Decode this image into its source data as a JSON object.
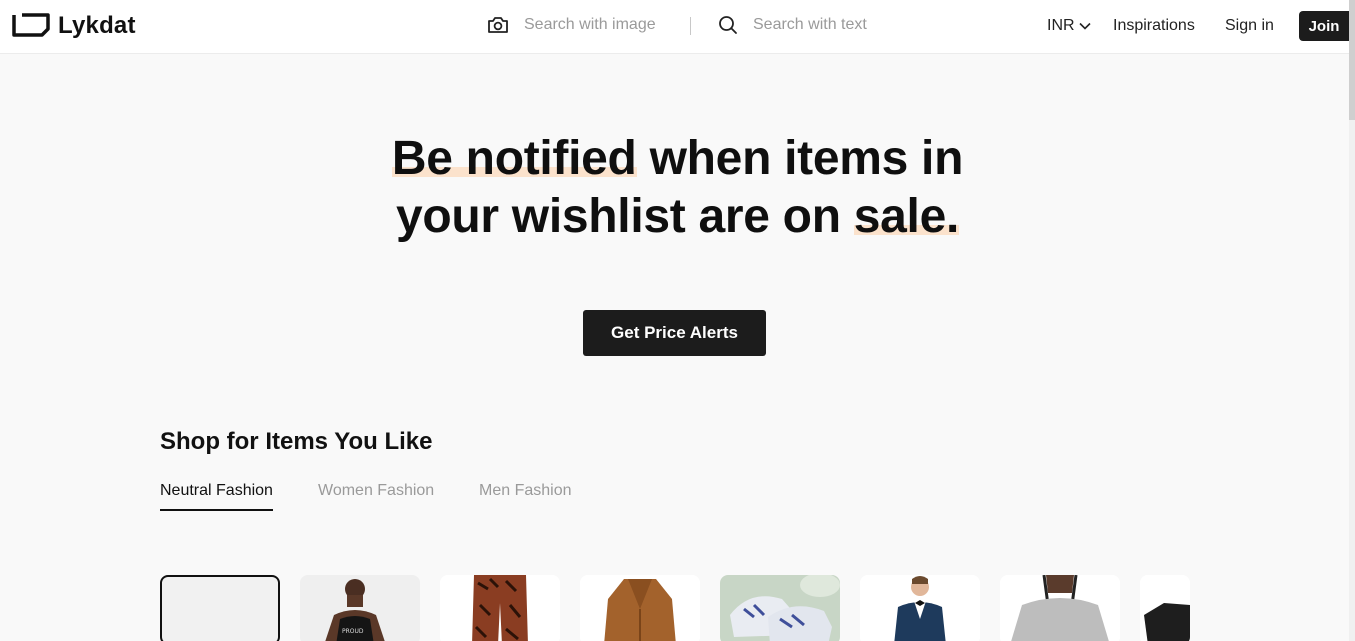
{
  "header": {
    "logo_text": "Lykdat",
    "search_image_placeholder": "Search with image",
    "search_text_placeholder": "Search with text",
    "currency": "INR",
    "inspirations": "Inspirations",
    "sign_in": "Sign in",
    "join": "Join"
  },
  "hero": {
    "line1_highlight": "Be notified",
    "line1_rest": " when items in",
    "line2_rest": "your wishlist are on ",
    "line2_highlight": "sale.",
    "cta": "Get Price Alerts"
  },
  "shop": {
    "title": "Shop for Items You Like",
    "tabs": [
      "Neutral Fashion",
      "Women Fashion",
      "Men Fashion"
    ],
    "active_tab": "Neutral Fashion"
  },
  "colors": {
    "accent_dark": "#1c1c1c",
    "highlight": "#fbe2cc",
    "muted_text": "#9a9a9a"
  }
}
